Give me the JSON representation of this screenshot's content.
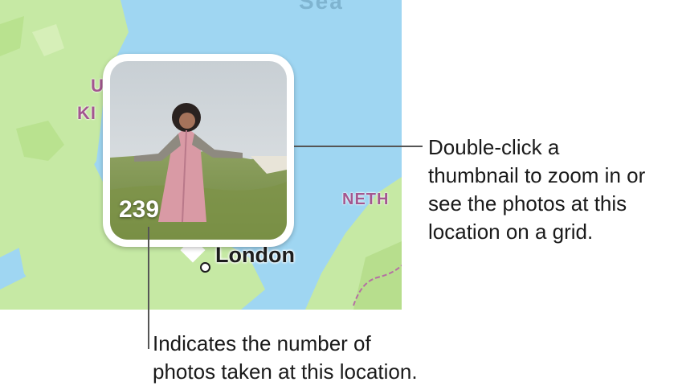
{
  "map": {
    "sea_label": "Sea",
    "country_label_1": [
      "U",
      "KI"
    ],
    "country_label_2": "NETH",
    "city_label": "London"
  },
  "pin": {
    "photo_count": "239",
    "photo_icon": "woman-in-field-photo"
  },
  "callouts": {
    "thumbnail": [
      "Double-click a",
      "thumbnail to zoom in or",
      "see the photos at this",
      "location on a grid."
    ],
    "count": [
      "Indicates the number of",
      "photos taken at this location."
    ]
  },
  "colors": {
    "water": "#9fd6f2",
    "land": "#c6e9a4",
    "pin_border": "#ffffff",
    "label_purple": "#a3578f"
  }
}
